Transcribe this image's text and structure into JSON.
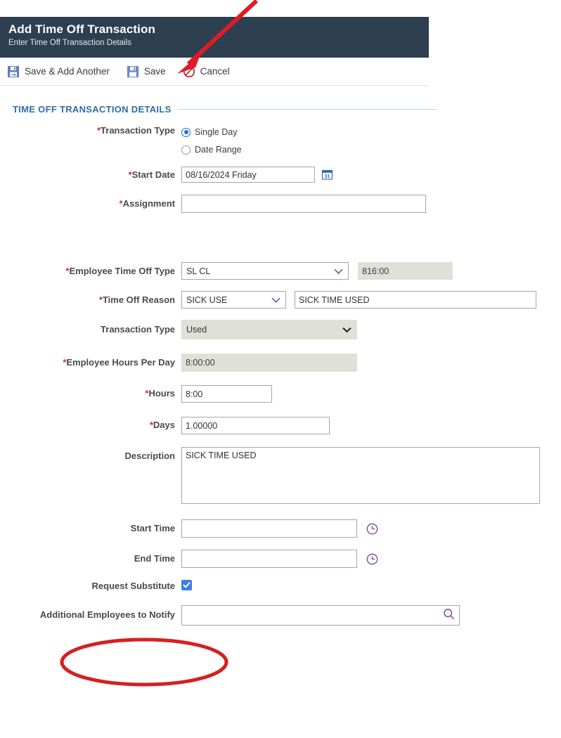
{
  "header": {
    "title": "Add Time Off Transaction",
    "subtitle": "Enter Time Off Transaction Details",
    "bg_color": "#2e3f50"
  },
  "toolbar": {
    "save_add_another_label": "Save & Add Another",
    "save_label": "Save",
    "cancel_label": "Cancel"
  },
  "section": {
    "title": "TIME OFF TRANSACTION DETAILS",
    "accent_color": "#2f6da8"
  },
  "fields": {
    "transaction_type_radio": {
      "label": "Transaction Type",
      "required": true,
      "options": [
        "Single Day",
        "Date Range"
      ],
      "selected": "Single Day"
    },
    "start_date": {
      "label": "Start Date",
      "required": true,
      "value": "08/16/2024 Friday",
      "calendar_icon_day": "31"
    },
    "assignment": {
      "label": "Assignment",
      "required": true,
      "value": ""
    },
    "employee_time_off_type": {
      "label": "Employee Time Off Type",
      "required": true,
      "value": "SL CL",
      "balance": "816:00"
    },
    "time_off_reason": {
      "label": "Time Off Reason",
      "required": true,
      "value": "SICK USE",
      "description_value": "SICK TIME USED"
    },
    "transaction_type_select": {
      "label": "Transaction Type",
      "required": false,
      "value": "Used"
    },
    "employee_hours_per_day": {
      "label": "Employee Hours Per Day",
      "required": true,
      "value": "8:00:00"
    },
    "hours": {
      "label": "Hours",
      "required": true,
      "value": "8:00"
    },
    "days": {
      "label": "Days",
      "required": true,
      "value": "1.00000"
    },
    "description": {
      "label": "Description",
      "required": false,
      "value": "SICK TIME USED"
    },
    "start_time": {
      "label": "Start Time",
      "required": false,
      "value": ""
    },
    "end_time": {
      "label": "End Time",
      "required": false,
      "value": ""
    },
    "request_substitute": {
      "label": "Request Substitute",
      "required": false,
      "checked": true
    },
    "additional_employees_to_notify": {
      "label": "Additional Employees to Notify",
      "required": false,
      "value": ""
    }
  },
  "annotations": {
    "arrow_color": "#e01b24",
    "ellipse_color": "#d62020",
    "arrow_target": "Save",
    "ellipse_target": "Request Substitute"
  }
}
